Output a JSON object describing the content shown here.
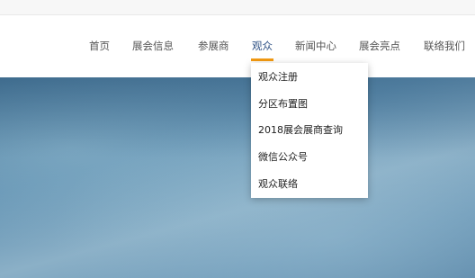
{
  "nav": {
    "items": [
      {
        "label": "首页"
      },
      {
        "label": "展会信息"
      },
      {
        "label": "参展商"
      },
      {
        "label": "观众"
      },
      {
        "label": "新闻中心"
      },
      {
        "label": "展会亮点"
      },
      {
        "label": "联络我们"
      }
    ],
    "active_index": 3,
    "accent_color": "#f39a12"
  },
  "dropdown": {
    "items": [
      {
        "label": "观众注册"
      },
      {
        "label": "分区布置图"
      },
      {
        "label": "2018展会展商查询"
      },
      {
        "label": "微信公众号"
      },
      {
        "label": "观众联络"
      }
    ]
  }
}
